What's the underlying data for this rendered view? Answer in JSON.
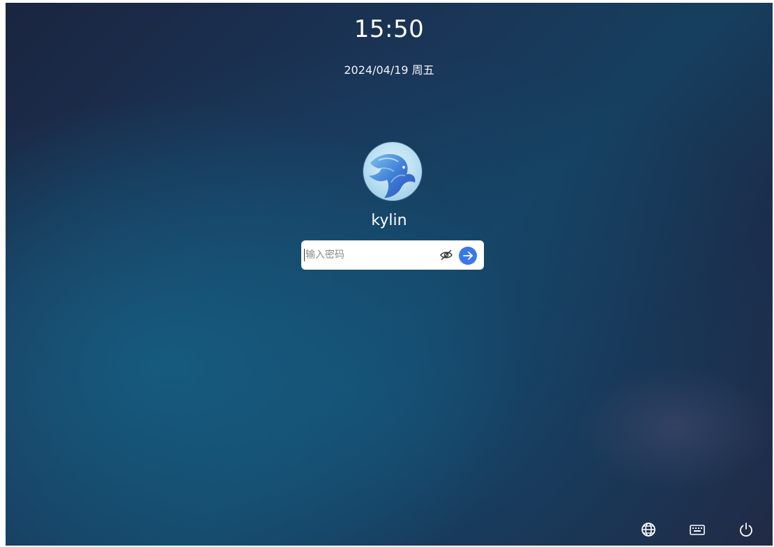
{
  "lock_screen": {
    "time": "15:50",
    "date": "2024/04/19 周五",
    "user": {
      "name": "kylin",
      "avatar_icon": "kylin-dragon-avatar"
    },
    "password": {
      "placeholder": "输入密码",
      "value": "",
      "toggle_icon": "eye-hidden-icon",
      "submit_icon": "arrow-right-icon",
      "submit_color": "#3b78e7"
    },
    "tray": [
      {
        "icon": "network-globe-icon"
      },
      {
        "icon": "keyboard-icon"
      },
      {
        "icon": "power-icon"
      }
    ]
  }
}
